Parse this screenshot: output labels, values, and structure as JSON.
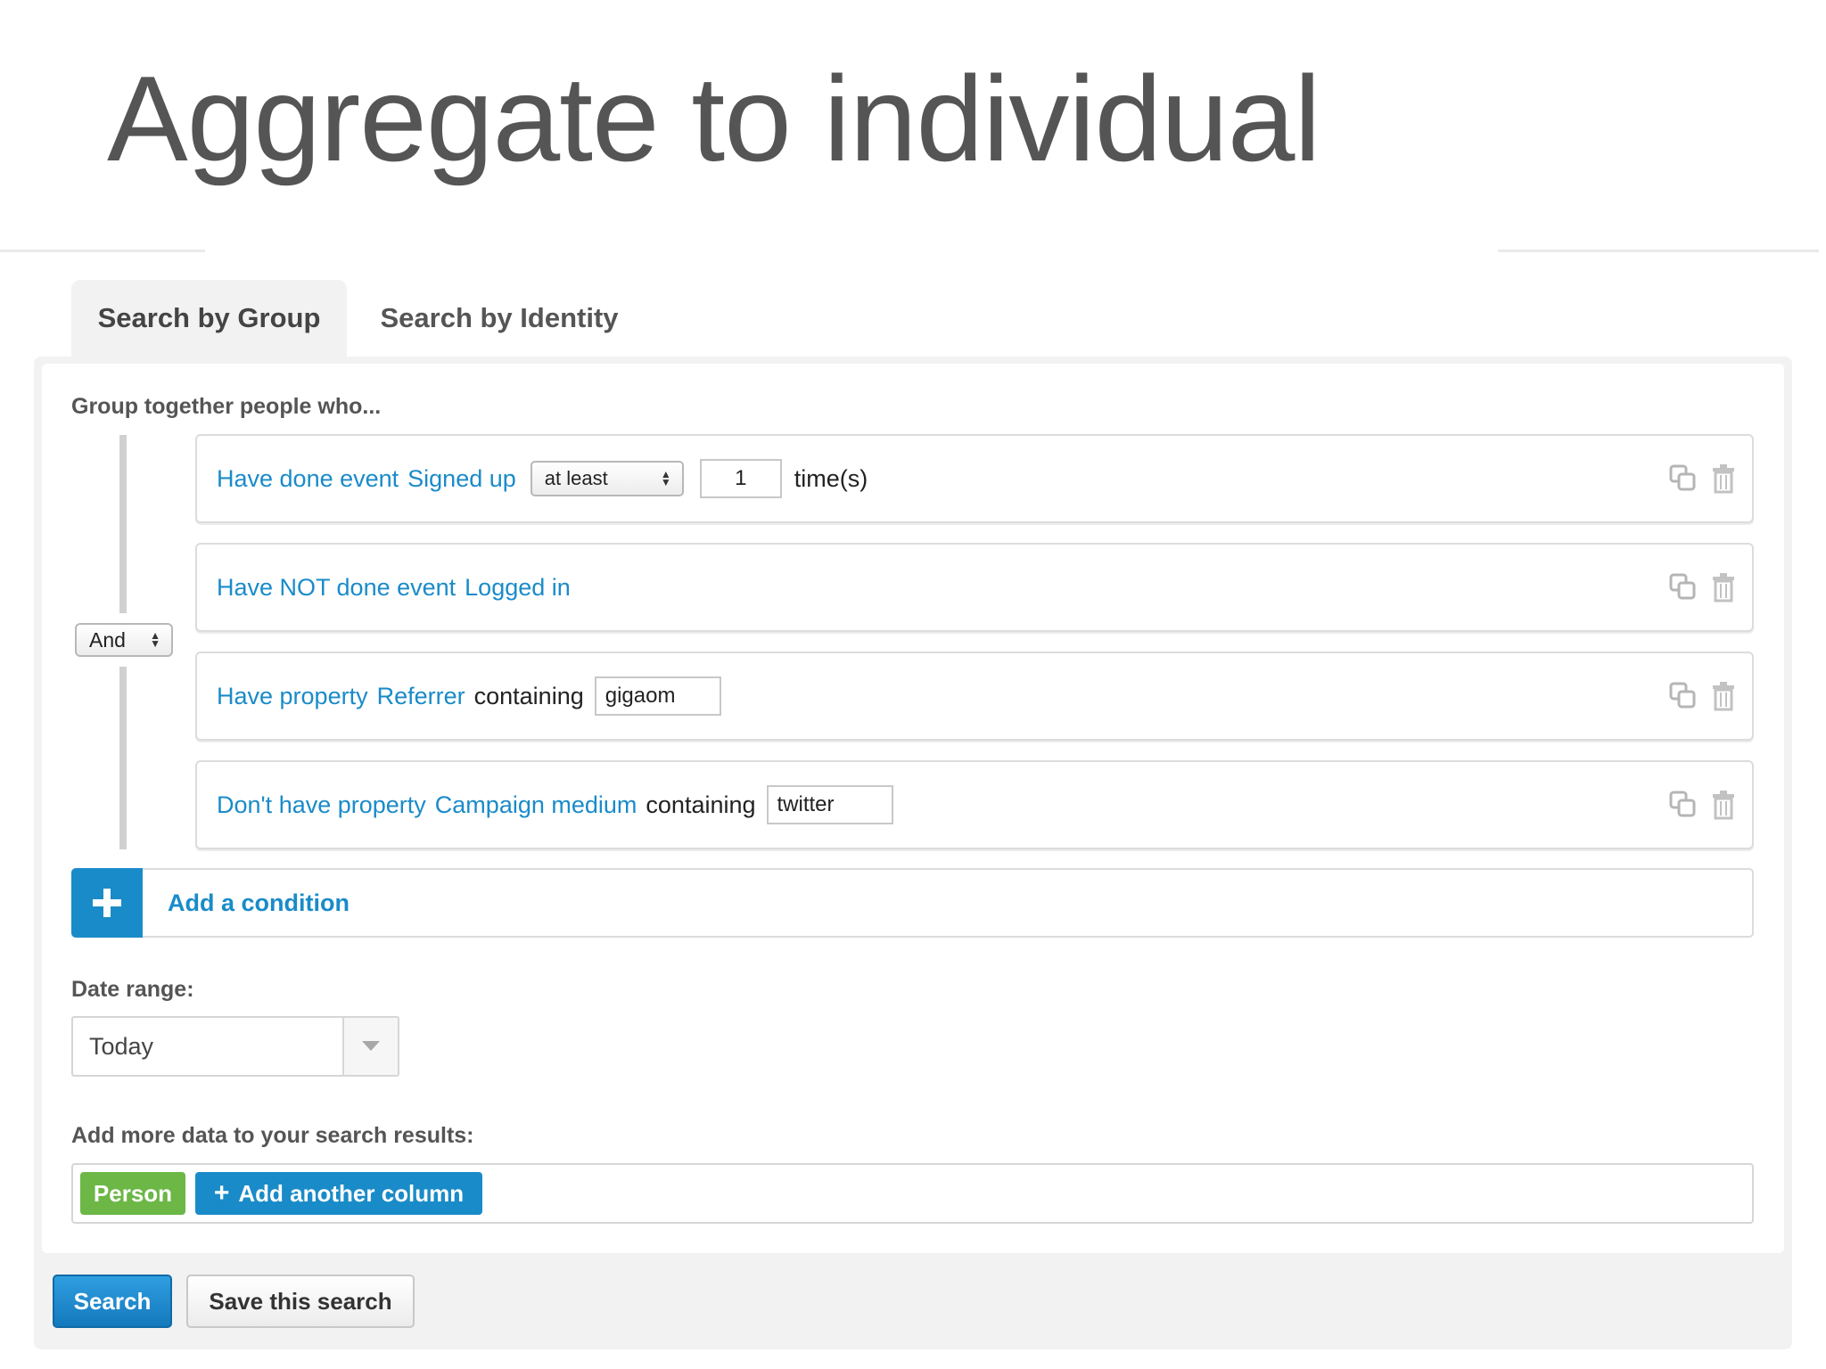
{
  "slide": {
    "title": "Aggregate to individual"
  },
  "tabs": [
    {
      "label": "Search by Group",
      "active": true
    },
    {
      "label": "Search by Identity",
      "active": false
    }
  ],
  "group_heading": "Group together people who...",
  "combinator": "And",
  "conditions": [
    {
      "type": "Have done event",
      "subject": "Signed up",
      "operator": "at least",
      "value": "1",
      "suffix": "time(s)"
    },
    {
      "type": "Have NOT done event",
      "subject": "Logged in"
    },
    {
      "type": "Have property",
      "subject": "Referrer",
      "operator": "containing",
      "value": "gigaom"
    },
    {
      "type": "Don't have property",
      "subject": "Campaign medium",
      "operator": "containing",
      "value": "twitter"
    }
  ],
  "add_condition_label": "Add a condition",
  "date_range": {
    "label": "Date range:",
    "selected": "Today"
  },
  "columns": {
    "label": "Add more data to your search results:",
    "items": [
      "Person"
    ],
    "add_label": "Add another column"
  },
  "buttons": {
    "search": "Search",
    "save": "Save this search"
  },
  "colors": {
    "link_blue": "#1a8bc9",
    "person_green": "#6cb746",
    "title_gray": "#555555"
  },
  "icons": {
    "row_copy": "copy-icon",
    "row_delete": "trash-icon",
    "add": "plus-icon",
    "dropdown": "caret-down-icon"
  }
}
